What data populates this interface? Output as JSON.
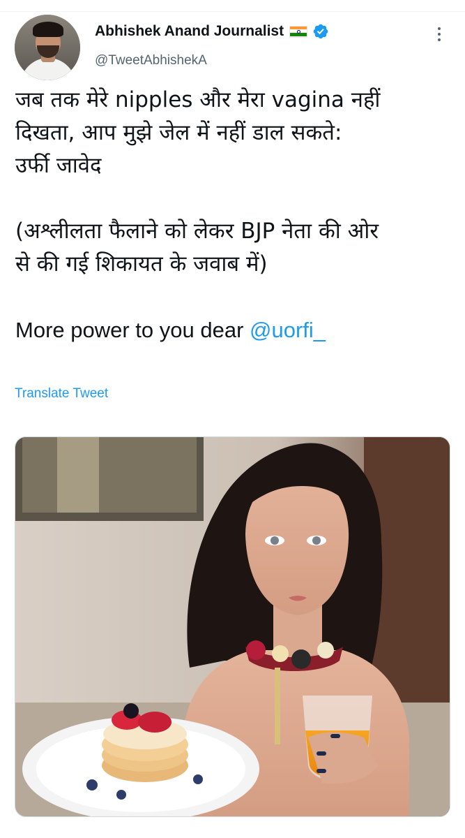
{
  "author": {
    "display_name": "Abhishek Anand Journalist",
    "handle": "@TweetAbhishekA",
    "flag_icon": "india-flag-icon",
    "verified_icon": "verified-badge-icon",
    "verified_color": "#1d9bf0"
  },
  "tweet": {
    "lines": [
      "जब तक मेरे nipples और मेरा vagina नहीं",
      "दिखता, आप मुझे जेल में नहीं डाल सकते:",
      "उर्फी जावेद",
      "(अश्लीलता फैलाने को लेकर BJP नेता की ओर",
      "से की गई शिकायत के जवाब में)"
    ],
    "closing_text": "More power to you dear ",
    "mention": "@uorfi_",
    "translate_label": "Translate Tweet"
  },
  "colors": {
    "link": "#1d9bf0",
    "text": "#0f1419",
    "secondary": "#536471"
  },
  "media": {
    "type": "photo"
  }
}
